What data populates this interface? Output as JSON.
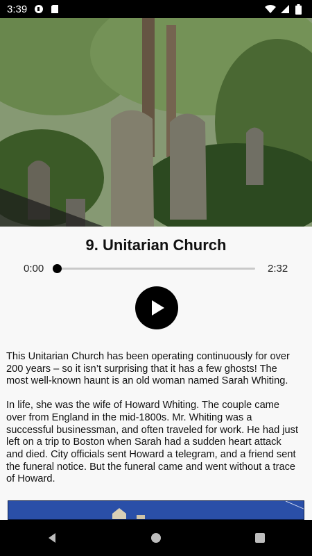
{
  "status_bar": {
    "time": "3:39",
    "icons_left": [
      "notification-icon",
      "sd-card-icon"
    ],
    "icons_right": [
      "wifi-icon",
      "cell-signal-icon",
      "battery-icon"
    ]
  },
  "hero": {
    "icon": "graveyard-photo"
  },
  "player": {
    "title": "9. Unitarian Church",
    "current_time": "0:00",
    "duration": "2:32",
    "progress": 0,
    "play_icon": "play-icon"
  },
  "article": {
    "paragraphs": [
      "This Unitarian Church has been operating continuously for over 200 years – so it isn’t surprising that it has a few ghosts! The most well-known haunt is an old woman named Sarah Whiting.",
      "In life, she was the wife of Howard Whiting. The couple came over from England in the mid-1800s. Mr. Whiting was a successful businessman, and often traveled for work. He had just left on a trip to Boston when Sarah had a sudden heart attack and died. City officials sent Howard a telegram, and a friend sent the funeral notice. But the funeral came and went without a trace of Howard."
    ]
  },
  "nav_bar": {
    "back": "back-icon",
    "home": "home-icon",
    "recents": "recents-icon"
  },
  "colors": {
    "status_bar": "#000000",
    "nav_bar": "#000000",
    "background": "#f8f8f8",
    "accent": "#000000"
  }
}
